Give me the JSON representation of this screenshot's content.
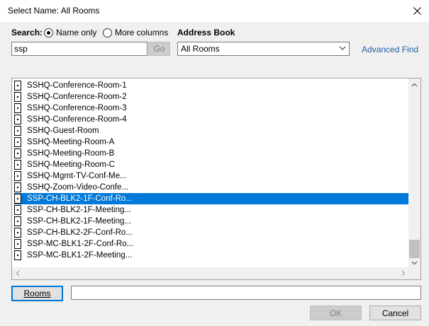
{
  "window": {
    "title": "Select Name: All Rooms",
    "close_icon": "close-icon"
  },
  "search": {
    "label": "Search:",
    "value": "ssp",
    "go_label": "Go",
    "options": {
      "name_only": "Name only",
      "more_columns": "More columns",
      "selected": "name_only"
    }
  },
  "address_book": {
    "label": "Address Book",
    "selected": "All Rooms",
    "advanced_find": "Advanced Find"
  },
  "results": {
    "items": [
      "SSHQ-Conference-Room-1",
      "SSHQ-Conference-Room-2",
      "SSHQ-Conference-Room-3",
      "SSHQ-Conference-Room-4",
      "SSHQ-Guest-Room",
      "SSHQ-Meeting-Room-A",
      "SSHQ-Meeting-Room-B",
      "SSHQ-Meeting-Room-C",
      "SSHQ-Mgmt-TV-Conf-Me...",
      "SSHQ-Zoom-Video-Confe...",
      "SSP-CH-BLK2-1F-Conf-Ro...",
      "SSP-CH-BLK2-1F-Meeting...",
      "SSP-CH-BLK2-1F-Meeting...",
      "SSP-CH-BLK2-2F-Conf-Ro...",
      "SSP-MC-BLK1-2F-Conf-Ro...",
      "SSP-MC-BLK1-2F-Meeting..."
    ],
    "selected_index": 10
  },
  "footer": {
    "rooms_button": "Rooms",
    "rooms_value": "",
    "ok_label": "OK",
    "cancel_label": "Cancel"
  },
  "colors": {
    "selection": "#0078d7",
    "link": "#1f5ea8",
    "background": "#f0f0f0"
  }
}
